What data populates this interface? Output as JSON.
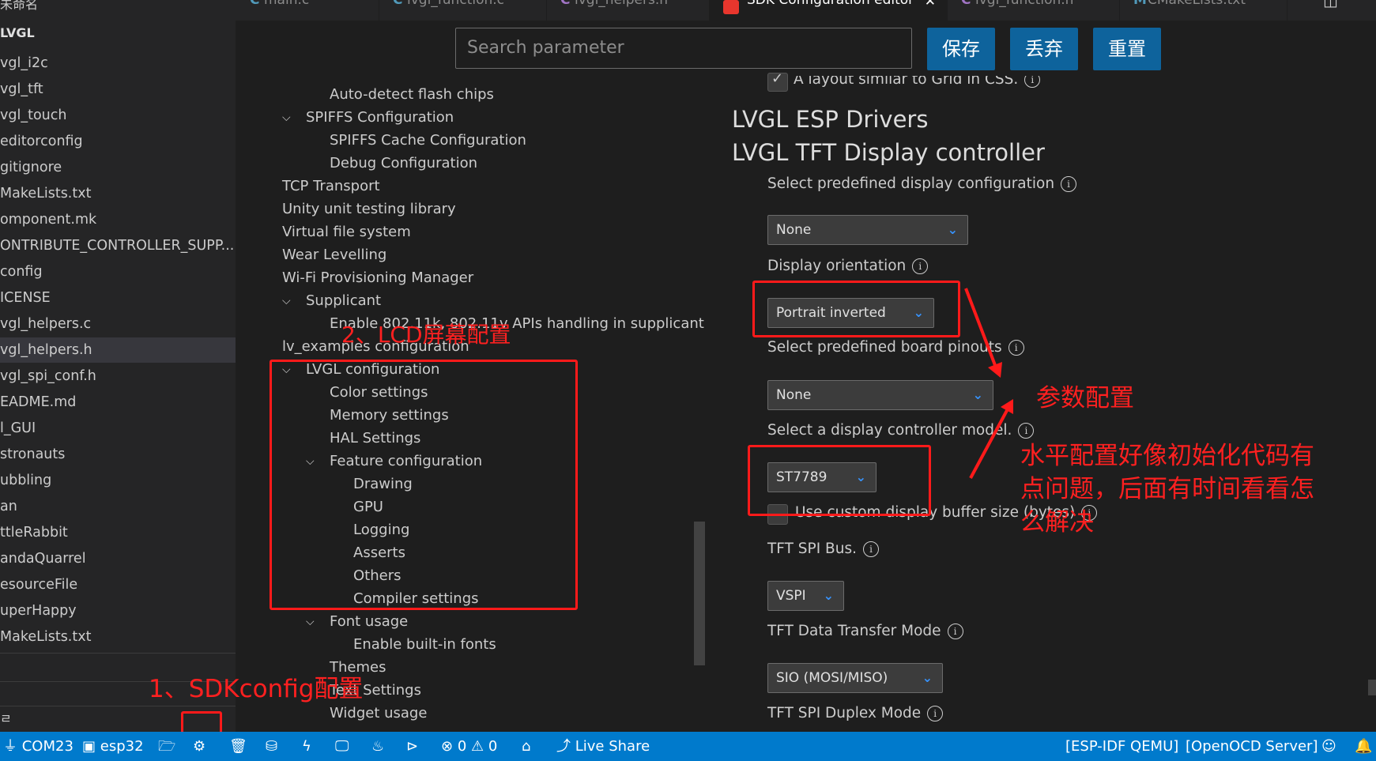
{
  "explorer": {
    "top_cut_label": "未命名",
    "top_menu_icon": "more-icon",
    "section_title": "LVGL",
    "files": [
      {
        "label": "vgl_i2c"
      },
      {
        "label": "vgl_tft"
      },
      {
        "label": "vgl_touch"
      },
      {
        "label": "editorconfig"
      },
      {
        "label": "gitignore"
      },
      {
        "label": "MakeLists.txt"
      },
      {
        "label": "omponent.mk"
      },
      {
        "label": "ONTRIBUTE_CONTROLLER_SUPP..."
      },
      {
        "label": "config"
      },
      {
        "label": "ICENSE"
      },
      {
        "label": "vgl_helpers.c"
      },
      {
        "label": "vgl_helpers.h",
        "selected": true
      },
      {
        "label": "vgl_spi_conf.h"
      },
      {
        "label": "EADME.md"
      },
      {
        "label": "l_GUI"
      },
      {
        "label": "stronauts"
      },
      {
        "label": "ubbling"
      },
      {
        "label": "an"
      },
      {
        "label": "ttleRabbit"
      },
      {
        "label": "andaQuarrel"
      },
      {
        "label": "esourceFile"
      },
      {
        "label": "uperHappy"
      },
      {
        "label": "MakeLists.txt"
      }
    ],
    "outline_label": "ㄹ"
  },
  "tabs": [
    {
      "label": "main.c",
      "icon": "C",
      "icon_color": "#519aba"
    },
    {
      "label": "lvgl_function.c",
      "icon": "C",
      "icon_color": "#519aba"
    },
    {
      "label": "lvgl_helpers.h",
      "icon": "C",
      "icon_color": "#a074c4"
    },
    {
      "label": "SDK Configuration editor",
      "icon": "espressif-icon",
      "icon_color": "#e8362d",
      "active": true,
      "close": "✕"
    },
    {
      "label": "lvgl_function.h",
      "icon": "C",
      "icon_color": "#a074c4"
    },
    {
      "label": "CMakeLists.txt",
      "icon": "M",
      "icon_color": "#519aba"
    }
  ],
  "toolbar": {
    "search_placeholder": "Search parameter",
    "save_label": "保存",
    "discard_label": "丢弃",
    "reset_label": "重置"
  },
  "tree": [
    {
      "label": "Auto-detect flash chips",
      "indent": 2
    },
    {
      "label": "SPIFFS Configuration",
      "indent": 1,
      "expanded": true
    },
    {
      "label": "SPIFFS Cache Configuration",
      "indent": 2
    },
    {
      "label": "Debug Configuration",
      "indent": 2
    },
    {
      "label": "TCP Transport",
      "indent": 0
    },
    {
      "label": "Unity unit testing library",
      "indent": 0
    },
    {
      "label": "Virtual file system",
      "indent": 0
    },
    {
      "label": "Wear Levelling",
      "indent": 0
    },
    {
      "label": "Wi-Fi Provisioning Manager",
      "indent": 0
    },
    {
      "label": "Supplicant",
      "indent": 1,
      "expanded": true
    },
    {
      "label": "Enable 802.11k, 802.11v APIs handling in supplicant",
      "indent": 2
    },
    {
      "label": "lv_examples configuration",
      "indent": 0
    },
    {
      "label": "LVGL configuration",
      "indent": 1,
      "expanded": true
    },
    {
      "label": "Color settings",
      "indent": 2
    },
    {
      "label": "Memory settings",
      "indent": 2
    },
    {
      "label": "HAL Settings",
      "indent": 2
    },
    {
      "label": "Feature configuration",
      "indent": 2,
      "expanded": true
    },
    {
      "label": "Drawing",
      "indent": 3
    },
    {
      "label": "GPU",
      "indent": 3
    },
    {
      "label": "Logging",
      "indent": 3
    },
    {
      "label": "Asserts",
      "indent": 3
    },
    {
      "label": "Others",
      "indent": 3
    },
    {
      "label": "Compiler settings",
      "indent": 3
    },
    {
      "label": "Font usage",
      "indent": 2,
      "expanded": true
    },
    {
      "label": "Enable built-in fonts",
      "indent": 3
    },
    {
      "label": "Themes",
      "indent": 2
    },
    {
      "label": "Text Settings",
      "indent": 2
    },
    {
      "label": "Widget usage",
      "indent": 2
    }
  ],
  "config": {
    "cut_checkbox_label": "A layout similar to Grid in CSS.",
    "heading_drivers": "LVGL ESP Drivers",
    "heading_tft": "LVGL TFT Display controller",
    "predefined_display_label": "Select predefined display configuration",
    "predefined_display_value": "None",
    "orientation_label": "Display orientation",
    "orientation_value": "Portrait inverted",
    "board_pinouts_label": "Select predefined board pinouts",
    "board_pinouts_value": "None",
    "controller_model_label": "Select a display controller model.",
    "controller_model_value": "ST7789",
    "custom_buffer_label": "Use custom display buffer size (bytes)",
    "spi_bus_label": "TFT SPI Bus.",
    "spi_bus_value": "VSPI",
    "transfer_mode_label": "TFT Data Transfer Mode",
    "transfer_mode_value": "SIO (MOSI/MISO)",
    "duplex_mode_label": "TFT SPI Duplex Mode",
    "info_glyph": "i",
    "dropdown_glyph": "⌄"
  },
  "annotations": {
    "lcd_config": "2、LCD屏幕配置",
    "param_config": "参数配置",
    "note_line1": "水平配置好像初始化代码有",
    "note_line2": "点问题，后面有时间看看怎",
    "note_line3": "么解决",
    "sdkconfig": "1、SDKconfig配置",
    "color": "#ff1a1a"
  },
  "statusbar": {
    "port": "COM23",
    "target": "esp32",
    "errors": "0",
    "warnings": "0",
    "live_share": "Live Share",
    "qemu": "[ESP-IDF QEMU]",
    "openocd": "[OpenOCD Server]",
    "accent": "#007acc"
  }
}
